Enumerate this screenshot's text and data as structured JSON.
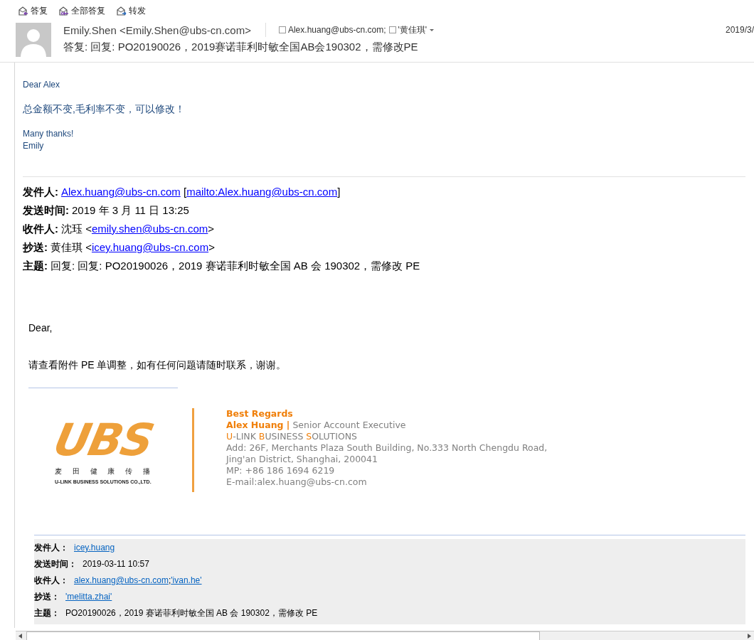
{
  "toolbar": [
    {
      "kind": "reply",
      "label": "答复"
    },
    {
      "kind": "reply_all",
      "label": "全部答复"
    },
    {
      "kind": "forward",
      "label": "转发"
    }
  ],
  "header": {
    "sender": "Emily.Shen <Emily.Shen@ubs-cn.com>",
    "recipients": [
      {
        "name": "Alex.huang@ubs-cn.com;",
        "checked": false
      },
      {
        "name": "'黄佳琪'",
        "checked": false
      }
    ],
    "date": "2019/3/",
    "subject": "答复: 回复: PO20190026，2019赛诺菲利时敏全国AB会190302，需修改PE"
  },
  "reply": {
    "greeting": "Dear Alex",
    "message": "总金额不变,毛利率不变，可以修改！",
    "closing": [
      "Many thanks!",
      "Emily"
    ]
  },
  "quoted_header": [
    {
      "label": "发件人:",
      "parts": [
        {
          "kind": "link",
          "text": "Alex.huang@ubs-cn.com"
        },
        {
          "kind": "text",
          "text": " ["
        },
        {
          "kind": "link",
          "text": "mailto:Alex.huang@ubs-cn.com"
        },
        {
          "kind": "text",
          "text": "]"
        }
      ]
    },
    {
      "label": "发送时间:",
      "parts": [
        {
          "kind": "text",
          "text": "2019 年 3 月 11 日 13:25"
        }
      ]
    },
    {
      "label": "收件人:",
      "parts": [
        {
          "kind": "text",
          "text": "沈珏 <"
        },
        {
          "kind": "link",
          "text": "emily.shen@ubs-cn.com"
        },
        {
          "kind": "text",
          "text": ">"
        }
      ]
    },
    {
      "label": "抄送:",
      "parts": [
        {
          "kind": "text",
          "text": "黄佳琪 <"
        },
        {
          "kind": "link",
          "text": "icey.huang@ubs-cn.com"
        },
        {
          "kind": "text",
          "text": ">"
        }
      ]
    },
    {
      "label": "主题:",
      "parts": [
        {
          "kind": "text",
          "text": "回复: 回复: PO20190026，2019 赛诺菲利时敏全国 AB 会 190302，需修改 PE"
        }
      ]
    }
  ],
  "quoted_body": {
    "greeting": "Dear,",
    "message": "请查看附件 PE 单调整，如有任何问题请随时联系，谢谢。"
  },
  "signature": {
    "logo": {
      "letters": "UBS",
      "chinese": "麦 田 健 康 传 播",
      "english": "U-LINK BUSINESS SOLUTIONS CO.,LTD."
    },
    "regards": "Best Regards",
    "name": "Alex Huang |",
    "title": "Senior Account Executive",
    "company": [
      {
        "text": "U",
        "accent": true
      },
      {
        "text": "-LINK ",
        "accent": false
      },
      {
        "text": "B",
        "accent": true
      },
      {
        "text": "USINESS ",
        "accent": false
      },
      {
        "text": "S",
        "accent": true
      },
      {
        "text": "OLUTIONS",
        "accent": false
      }
    ],
    "lines": [
      "Add: 26F, Merchants Plaza South Building, No.333 North Chengdu Road,",
      "Jing'an District, Shanghai, 200041",
      "MP: +86 186 1694 6219",
      "E-mail:alex.huang@ubs-cn.com"
    ]
  },
  "earlier_header": [
    {
      "label": "发件人：",
      "parts": [
        {
          "kind": "link",
          "text": "icey.huang"
        }
      ]
    },
    {
      "label": "发送时间：",
      "parts": [
        {
          "kind": "text",
          "text": "2019-03-11 10:57"
        }
      ]
    },
    {
      "label": "收件人：",
      "parts": [
        {
          "kind": "link",
          "text": "alex.huang@ubs-cn.com"
        },
        {
          "kind": "text",
          "text": ";"
        },
        {
          "kind": "link",
          "text": "'ivan.he'"
        }
      ]
    },
    {
      "label": "抄送：",
      "parts": [
        {
          "kind": "link",
          "text": "'melitta.zhai'"
        }
      ]
    },
    {
      "label": "主题：",
      "parts": [
        {
          "kind": "text",
          "text": "PO20190026，2019 赛诺菲利时敏全国 AB 会 190302，需修改 PE"
        }
      ]
    }
  ]
}
